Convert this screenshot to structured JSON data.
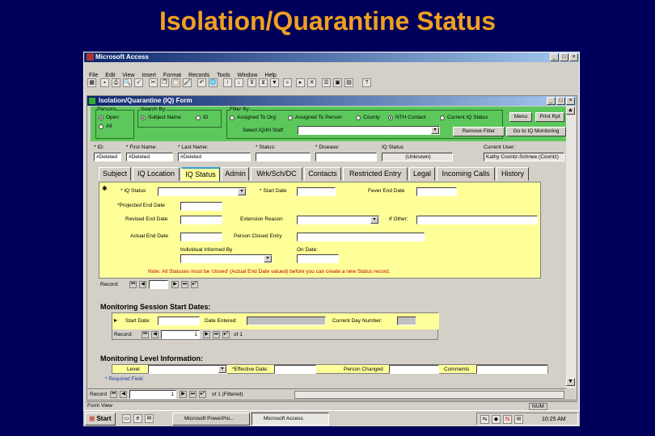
{
  "slide_title": "Isolation/Quarantine Status",
  "app": {
    "title": "Microsoft Access",
    "menu": [
      "File",
      "Edit",
      "View",
      "Insert",
      "Format",
      "Records",
      "Tools",
      "Window",
      "Help"
    ]
  },
  "form": {
    "title": "Isolation/Quarantine (IQ) Form",
    "filter": {
      "persons_label": "Persons",
      "search_by_label": "Search By:",
      "filter_by_label": "Filter By:",
      "open_label": "Open",
      "all_label": "All",
      "subject_name_label": "Subject Name",
      "id_label": "ID",
      "assigned_to_org_label": "Assigned To Org",
      "assigned_to_person_label": "Assigned To Person",
      "county_label": "County",
      "nth_contact_label": "NTH Contact",
      "current_iq_status_label": "Current IQ Status",
      "select_iq_staff_label": "Select IQ/IH Staff",
      "menu_button": "Menu",
      "print_rpt_button": "Print Rpt",
      "remove_filter_button": "Remove Filter",
      "to_monitoring_button": "Go to IQ Monitoring"
    },
    "header_cols": [
      "* ID:",
      "* First Name:",
      "* Last Name:",
      "* Status:",
      "* Disease:",
      "IQ Status",
      "Current User:"
    ],
    "header_vals": [
      "#Deleted",
      "#Deleted",
      "#Deleted",
      "",
      "",
      "(Unknown)",
      "Kathy Coontz-Schnee (Coontz)"
    ],
    "tabs": [
      "Subject",
      "IQ Location",
      "IQ Status",
      "Admin",
      "Wrk/Sch/DC",
      "Contacts",
      "Restricted Entry",
      "Legal",
      "Incoming Calls",
      "History"
    ],
    "active_tab": "IQ Status",
    "status": {
      "iq_status_label": "* IQ Status",
      "start_date_label": "* Start Date",
      "fever_end_date_label": "Fever End Date",
      "projected_end_date_label": "*Projected End Date",
      "revised_end_date_label": "Revised End Date",
      "extension_reason_label": "Extension Reason",
      "if_other_label": "If Other:",
      "actual_end_date_label": "Actual End Date",
      "person_closed_entry_label": "Person Closed Entry",
      "individual_informed_by_label": "Individual Informed By",
      "on_date_label": "On Date:",
      "note": "Note: All Statuses must be 'closed' (Actual End Date valued) before you can create a new Status record."
    },
    "subnav": {
      "record_label": "Record:"
    },
    "monitoring_session": {
      "title": "Monitoring Session Start Dates:",
      "start_date_label": "Start Date:",
      "date_entered_label": "Date Entered:",
      "current_day_label": "Current Day Number:",
      "record_label": "Record:",
      "record_num": "1",
      "of_total": "of 1"
    },
    "monitoring_level": {
      "title": "Monitoring Level Information:",
      "level_label": "Level",
      "effective_date_label": "*Effective Date:",
      "person_changed_label": "Person Changed",
      "comments_label": "Comments",
      "required_note": "* Required Field"
    },
    "record_nav": {
      "label": "Record",
      "num": "1",
      "of_text": "of 1 (Filtered)"
    }
  },
  "statusbar": {
    "text": "Form View",
    "num": "NUM"
  },
  "taskbar": {
    "start": "Start",
    "items": [
      "Microsoft PowerPoi...",
      "Microsoft Access"
    ],
    "time": "10:25 AM"
  }
}
